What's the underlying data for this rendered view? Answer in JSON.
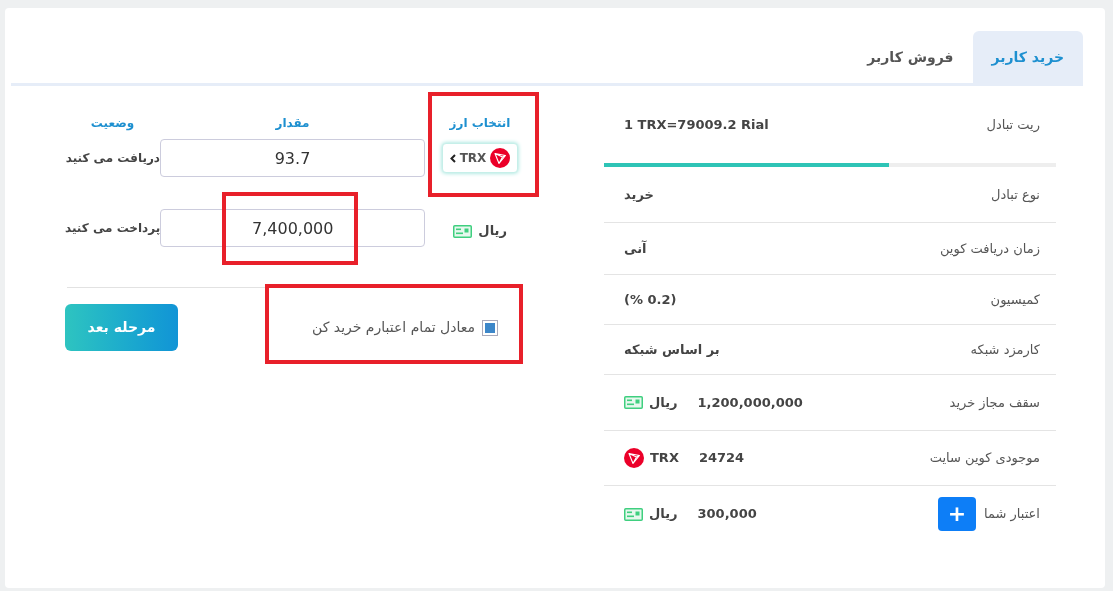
{
  "tabs": [
    {
      "label": "خرید کاربر",
      "selected": true
    },
    {
      "label": "فروش کاربر",
      "selected": false
    }
  ],
  "summary": {
    "rate": {
      "label": "ریت تبادل",
      "value": "1 TRX=79009.2 Rial"
    },
    "progress": {
      "level": 0.63
    },
    "rows": [
      {
        "kind": "text",
        "label": "نوع تبادل",
        "value": "خرید"
      },
      {
        "kind": "text",
        "label": "زمان دریافت کوین",
        "value": "آنی"
      },
      {
        "kind": "text",
        "label": "کمیسیون",
        "value": "(% 0.2)"
      },
      {
        "kind": "text",
        "label": "کارمزد شبکه",
        "value": "بر اساس شبکه"
      },
      {
        "kind": "money",
        "label": "سقف مجاز خرید",
        "value": "1,200,000,000",
        "unit": "ریال"
      },
      {
        "kind": "coin",
        "label": "موجودی کوین سایت",
        "value": "24724",
        "unit": "TRX"
      },
      {
        "kind": "credit",
        "label": "اعتبار شما",
        "button": "+",
        "value": "300,000",
        "unit": "ریال"
      }
    ]
  },
  "form": {
    "headers": [
      "انتخاب ارز",
      "مقدار",
      "وضعیت"
    ],
    "receive": {
      "label": "دریافت می کنید",
      "value": "93.7",
      "coin": "TRX"
    },
    "pay": {
      "label": "پرداخت می کنید",
      "value": "7,400,000",
      "currency": "ریال"
    },
    "checkbox": {
      "label": "معادل تمام اعتبارم خرید کن",
      "checked": true
    },
    "next_button": "مرحله بعد"
  }
}
